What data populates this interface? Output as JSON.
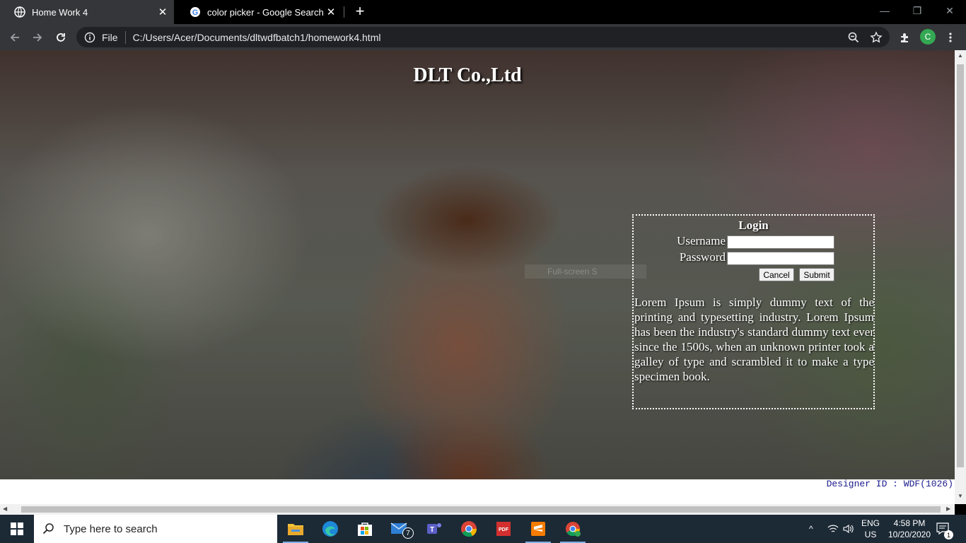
{
  "browser": {
    "tabs": [
      {
        "title": "Home Work 4",
        "active": true,
        "favicon": "globe-icon"
      },
      {
        "title": "color picker - Google Search",
        "active": false,
        "favicon": "google-icon"
      }
    ],
    "address": {
      "scheme_label": "File",
      "url": "C:/Users/Acer/Documents/dltwdfbatch1/homework4.html"
    },
    "profile_initial": "C"
  },
  "page": {
    "site_title": "DLT Co.,Ltd",
    "login": {
      "title": "Login",
      "username_label": "Username",
      "password_label": "Password",
      "username_value": "",
      "password_value": "",
      "cancel_label": "Cancel",
      "submit_label": "Submit"
    },
    "ghost_text": "Full-screen S",
    "lorem": "Lorem Ipsum is simply dummy text of the printing and typesetting industry. Lorem Ipsum has been the industry's standard dummy text ever since the 1500s, when an unknown printer took a galley of type and scrambled it to make a type specimen book.",
    "designer_id": "Designer ID : WDF(1026)"
  },
  "taskbar": {
    "search_placeholder": "Type here to search",
    "apps": [
      "file-explorer-icon",
      "edge-icon",
      "store-icon",
      "mail-icon",
      "teams-icon",
      "chrome-icon",
      "pdf-icon",
      "sublime-icon",
      "chrome-profile-icon"
    ],
    "mail_badge": "7",
    "language": "ENG",
    "region": "US",
    "time": "4:58 PM",
    "date": "10/20/2020",
    "notification_count": "1"
  }
}
